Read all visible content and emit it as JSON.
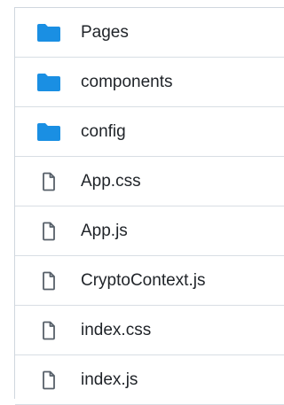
{
  "file_list": {
    "items": [
      {
        "name": "Pages",
        "type": "folder",
        "icon": "folder-icon"
      },
      {
        "name": "components",
        "type": "folder",
        "icon": "folder-icon"
      },
      {
        "name": "config",
        "type": "folder",
        "icon": "folder-icon"
      },
      {
        "name": "App.css",
        "type": "file",
        "icon": "file-icon"
      },
      {
        "name": "App.js",
        "type": "file",
        "icon": "file-icon"
      },
      {
        "name": "CryptoContext.js",
        "type": "file",
        "icon": "file-icon"
      },
      {
        "name": "index.css",
        "type": "file",
        "icon": "file-icon"
      },
      {
        "name": "index.js",
        "type": "file",
        "icon": "file-icon"
      }
    ]
  },
  "colors": {
    "folder": "#1a8fe3",
    "file_icon": "#57606a",
    "text": "#1f2328",
    "border": "#d0d7de"
  }
}
